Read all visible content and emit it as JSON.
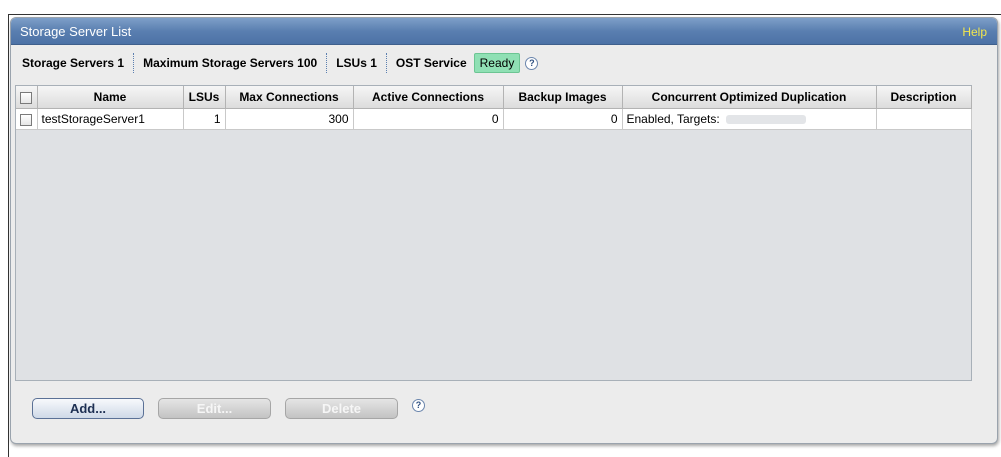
{
  "panel": {
    "title": "Storage Server List",
    "help_label": "Help"
  },
  "stats": {
    "storage_servers_label": "Storage Servers",
    "storage_servers_value": "1",
    "max_storage_servers_label": "Maximum Storage Servers",
    "max_storage_servers_value": "100",
    "lsus_label": "LSUs",
    "lsus_value": "1",
    "ost_service_label": "OST Service",
    "ost_service_status": "Ready",
    "help_glyph": "?"
  },
  "table": {
    "columns": [
      "Name",
      "LSUs",
      "Max Connections",
      "Active Connections",
      "Backup Images",
      "Concurrent Optimized Duplication",
      "Description"
    ],
    "rows": [
      {
        "name": "testStorageServer1",
        "lsus": "1",
        "max_connections": "300",
        "active_connections": "0",
        "backup_images": "0",
        "concurrent_optimized_duplication": "Enabled, Targets:",
        "description": ""
      }
    ]
  },
  "buttons": {
    "add": "Add...",
    "edit": "Edit...",
    "delete": "Delete",
    "help_glyph": "?"
  },
  "colors": {
    "header_blue": "#5a7fb0",
    "help_yellow": "#f2e64d",
    "ready_green": "#8fe0b4"
  },
  "icons": {
    "help": "question-circle-icon",
    "checkbox": "checkbox-icon"
  }
}
